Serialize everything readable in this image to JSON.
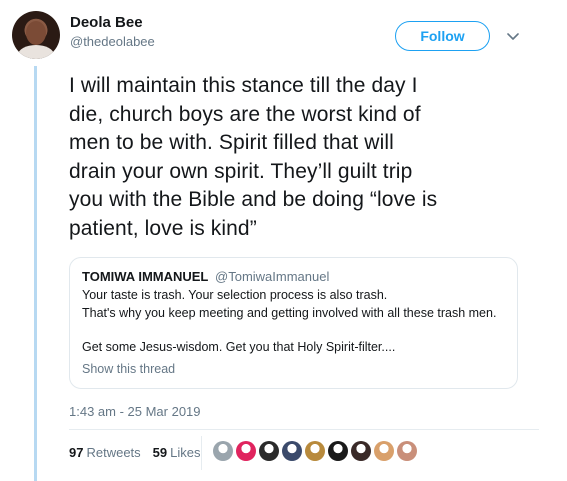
{
  "author": {
    "name": "Deola Bee",
    "handle": "@thedeolabee"
  },
  "follow_label": "Follow",
  "tweet_lines": [
    "I will maintain this stance till the day I",
    "die, church boys are the worst kind of",
    "men to be with. Spirit filled that will",
    "drain your own spirit. They’ll guilt trip",
    "you with the Bible and be doing “love is",
    "patient, love is kind”"
  ],
  "quote": {
    "name": "TOMIWA IMMANUEL",
    "handle": "@TomiwaImmanuel",
    "lines": [
      "Your taste is trash. Your selection process is also trash.",
      "That's why you keep meeting and getting involved with all these trash men.",
      "",
      "Get some Jesus-wisdom. Get you that Holy Spirit-filter...."
    ],
    "show_thread": "Show this thread"
  },
  "timestamp": "1:43 am - 25 Mar 2019",
  "stats": {
    "retweets_count": "97",
    "retweets_label": "Retweets",
    "likes_count": "59",
    "likes_label": "Likes"
  },
  "colors": {
    "accent": "#1da1f2",
    "thread_line": "#b7d9f2",
    "muted": "#657786"
  },
  "liker_avatar_colors": [
    "#9aa5ad",
    "#e0245e",
    "#2b2b2b",
    "#3b4a6b",
    "#b88a3c",
    "#1a1a1a",
    "#3a2a28",
    "#d9a06b",
    "#c98f7a"
  ]
}
